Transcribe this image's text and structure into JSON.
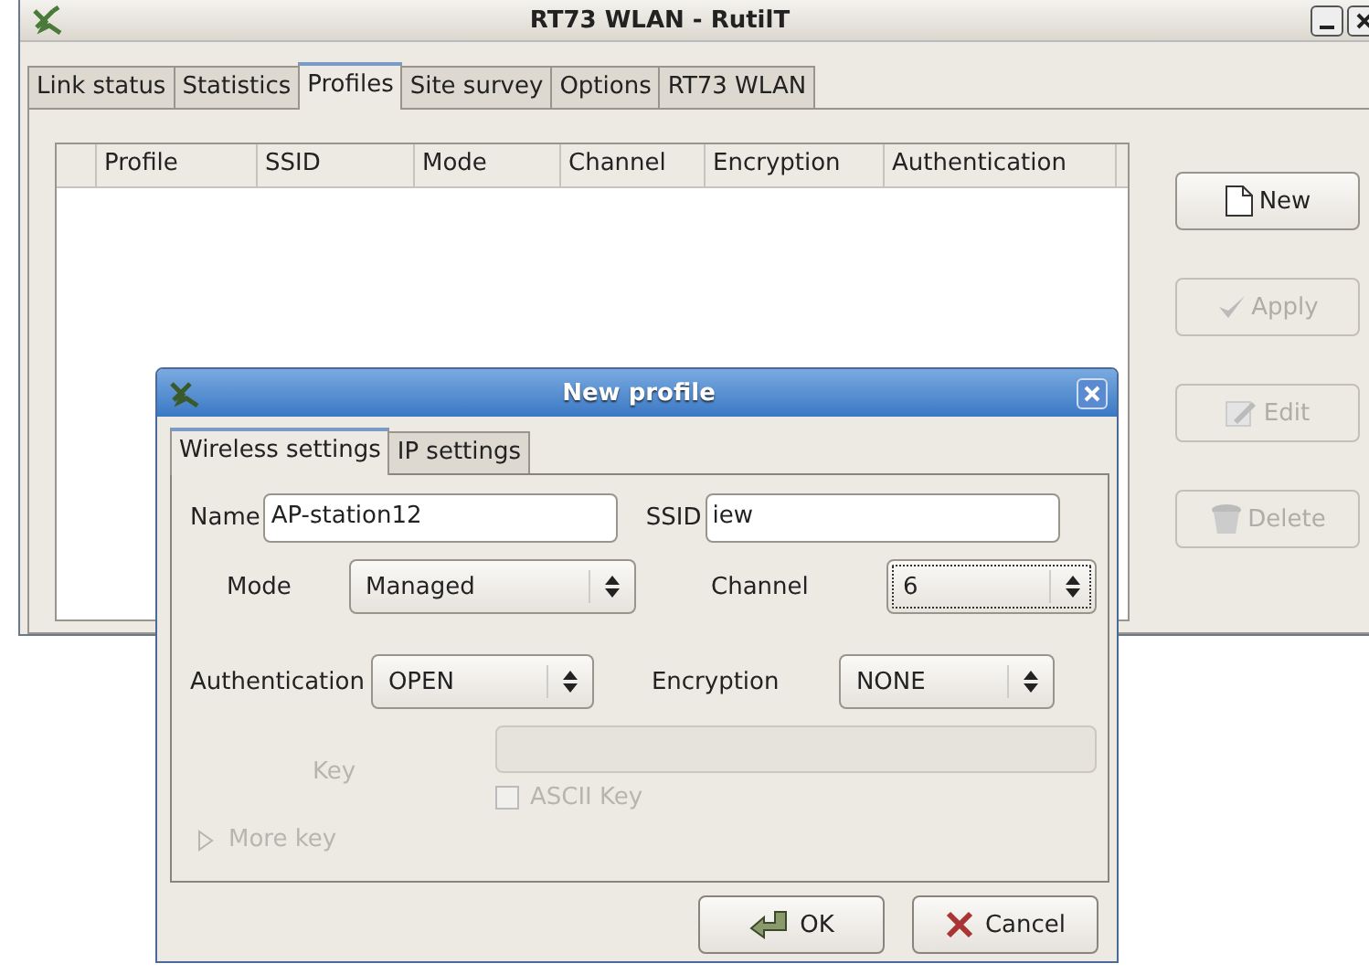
{
  "window": {
    "title": "RT73 WLAN - RutilT"
  },
  "tabs": [
    {
      "label": "Link status",
      "selected": false
    },
    {
      "label": "Statistics",
      "selected": false
    },
    {
      "label": "Profiles",
      "selected": true
    },
    {
      "label": "Site survey",
      "selected": false
    },
    {
      "label": "Options",
      "selected": false
    },
    {
      "label": "RT73 WLAN",
      "selected": false
    }
  ],
  "table": {
    "columns": [
      "Profile",
      "SSID",
      "Mode",
      "Channel",
      "Encryption",
      "Authentication"
    ]
  },
  "side_buttons": [
    {
      "label": "New",
      "kind": "new",
      "disabled": false
    },
    {
      "label": "Apply",
      "kind": "apply",
      "disabled": true
    },
    {
      "label": "Edit",
      "kind": "edit",
      "disabled": true
    },
    {
      "label": "Delete",
      "kind": "delete",
      "disabled": true
    }
  ],
  "dialog": {
    "title": "New profile",
    "tabs": [
      {
        "label": "Wireless settings",
        "selected": true
      },
      {
        "label": "IP settings",
        "selected": false
      }
    ],
    "name": {
      "label": "Name",
      "value": "AP-station12"
    },
    "ssid": {
      "label": "SSID",
      "value": "iew"
    },
    "mode": {
      "label": "Mode",
      "value": "Managed",
      "focused": false
    },
    "channel": {
      "label": "Channel",
      "value": "6",
      "focused": true
    },
    "authentication": {
      "label": "Authentication",
      "value": "OPEN",
      "focused": false
    },
    "encryption": {
      "label": "Encryption",
      "value": "NONE",
      "focused": false
    },
    "key": {
      "label": "Key",
      "disabled": true
    },
    "ascii_key": {
      "label": "ASCII Key",
      "checked": false,
      "disabled": true
    },
    "more_key": {
      "label": "More key",
      "expanded": false,
      "disabled": true
    },
    "buttons": [
      {
        "label": "OK",
        "kind": "ok"
      },
      {
        "label": "Cancel",
        "kind": "cancel"
      }
    ]
  }
}
